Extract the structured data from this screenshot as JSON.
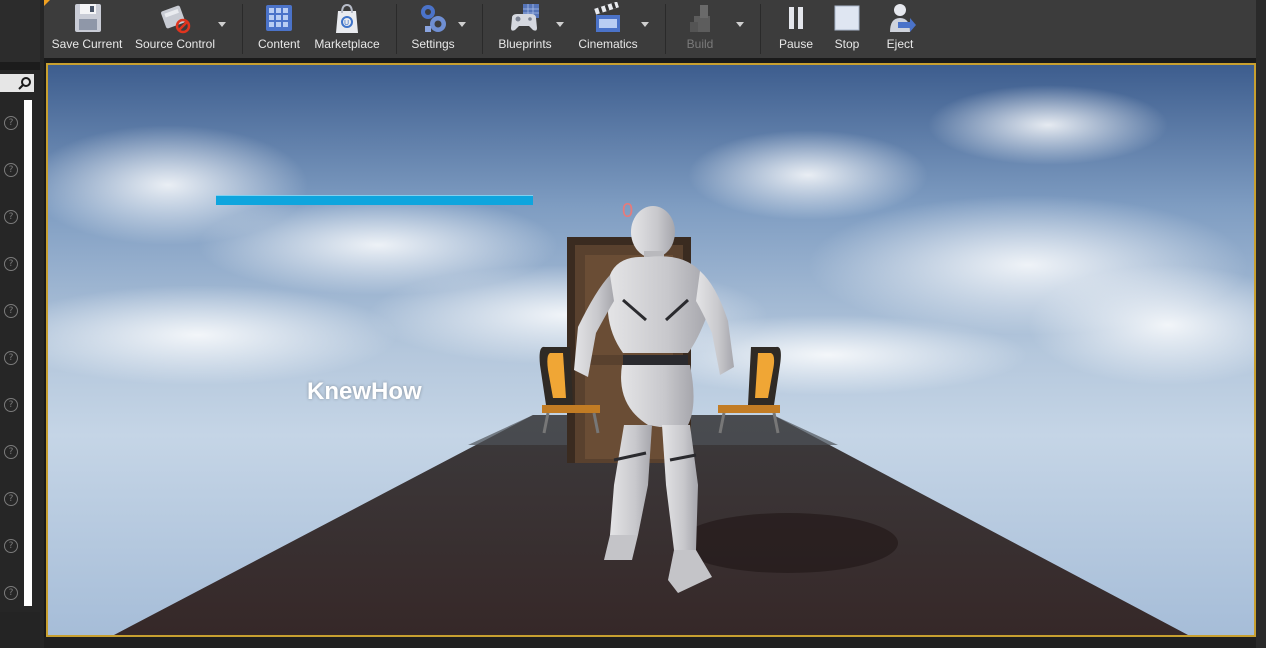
{
  "toolbar": {
    "buttons": [
      {
        "label": "Save Current",
        "icon": "floppy-disk-icon"
      },
      {
        "label": "Source Control",
        "icon": "source-control-icon"
      },
      {
        "label": "Content",
        "icon": "content-grid-icon"
      },
      {
        "label": "Marketplace",
        "icon": "marketplace-bag-icon"
      },
      {
        "label": "Settings",
        "icon": "settings-gears-icon"
      },
      {
        "label": "Blueprints",
        "icon": "blueprints-gamepad-icon"
      },
      {
        "label": "Cinematics",
        "icon": "clapperboard-icon"
      },
      {
        "label": "Build",
        "icon": "build-blocks-icon"
      },
      {
        "label": "Pause",
        "icon": "pause-icon"
      },
      {
        "label": "Stop",
        "icon": "stop-icon"
      },
      {
        "label": "Eject",
        "icon": "eject-person-icon"
      }
    ]
  },
  "left_panel": {
    "help_icon_glyph": "?"
  },
  "viewport": {
    "player_name": "KnewHow",
    "score": "0",
    "health_fraction": 1.0,
    "colors": {
      "selection_border": "#c8a030",
      "health_bar": "#0ea5de",
      "score_text": "#e87a7a"
    }
  }
}
